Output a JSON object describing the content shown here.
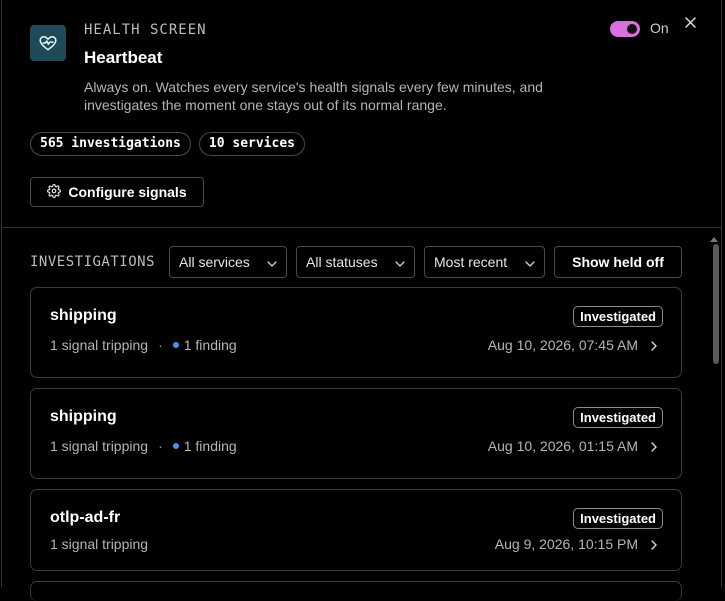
{
  "header": {
    "eyebrow": "HEALTH SCREEN",
    "title": "Heartbeat",
    "description": "Always on. Watches every service's health signals every few minutes, and investigates the moment one stays out of its normal range.",
    "toggle_label": "On",
    "toggle_state": true,
    "accent_color": "#d96fe0"
  },
  "stats": [
    {
      "label": "565 investigations"
    },
    {
      "label": "10 services"
    }
  ],
  "configure_label": "Configure signals",
  "investigations": {
    "label": "INVESTIGATIONS",
    "filters": [
      {
        "label": "All services"
      },
      {
        "label": "All statuses"
      },
      {
        "label": "Most recent"
      }
    ],
    "show_held_label": "Show held off",
    "items": [
      {
        "service": "shipping",
        "status": "Investigated",
        "signals": "1 signal tripping",
        "finding": "1 finding",
        "timestamp": "Aug 10, 2026, 07:45 AM"
      },
      {
        "service": "shipping",
        "status": "Investigated",
        "signals": "1 signal tripping",
        "finding": "1 finding",
        "timestamp": "Aug 10, 2026, 01:15 AM"
      },
      {
        "service": "otlp-ad-fr",
        "status": "Investigated",
        "signals": "1 signal tripping",
        "finding": "",
        "timestamp": "Aug 9, 2026, 10:15 PM"
      }
    ]
  },
  "icons": {
    "app": "heart-pulse-icon",
    "close": "close-icon",
    "configure": "gear-icon",
    "dropdown": "chevron-down-icon",
    "row": "chevron-right-icon"
  }
}
